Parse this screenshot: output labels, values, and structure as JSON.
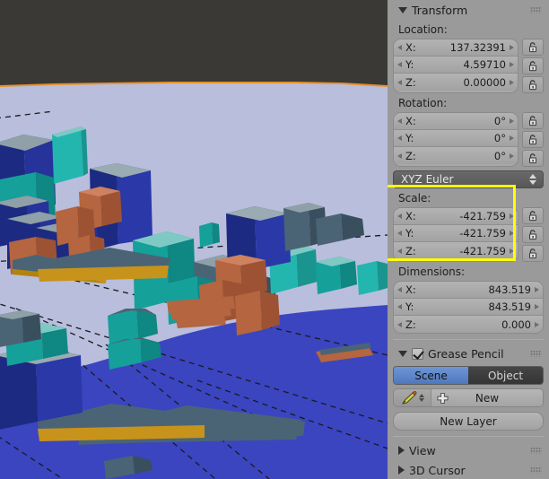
{
  "viewport": {
    "name": "3d-viewport",
    "background_color": "#3b3935",
    "ground_color": "#b9bedd",
    "water_color": "#3b45c0",
    "outline_color": "#e8912c",
    "building_colors": [
      "#1c2a82",
      "#15a09a",
      "#23b6ae",
      "#b5653f",
      "#c8931b",
      "#4a6475",
      "#8fa0a8"
    ]
  },
  "panel": {
    "transform": {
      "title": "Transform",
      "expanded": true,
      "location": {
        "label": "Location:",
        "rows": [
          {
            "axis": "X:",
            "value": "137.32391"
          },
          {
            "axis": "Y:",
            "value": "4.59710"
          },
          {
            "axis": "Z:",
            "value": "0.00000"
          }
        ],
        "locks": [
          "unlocked",
          "unlocked",
          "unlocked"
        ]
      },
      "rotation": {
        "label": "Rotation:",
        "rows": [
          {
            "axis": "X:",
            "value": "0°"
          },
          {
            "axis": "Y:",
            "value": "0°"
          },
          {
            "axis": "Z:",
            "value": "0°"
          }
        ],
        "locks": [
          "unlocked",
          "unlocked",
          "unlocked"
        ],
        "mode": "XYZ Euler"
      },
      "scale": {
        "label": "Scale:",
        "highlighted": true,
        "highlight_color": "#ffff00",
        "rows": [
          {
            "axis": "X:",
            "value": "-421.759"
          },
          {
            "axis": "Y:",
            "value": "-421.759"
          },
          {
            "axis": "Z:",
            "value": "-421.759"
          }
        ],
        "locks": [
          "unlocked",
          "unlocked",
          "unlocked"
        ]
      },
      "dimensions": {
        "label": "Dimensions:",
        "rows": [
          {
            "axis": "X:",
            "value": "843.519"
          },
          {
            "axis": "Y:",
            "value": "843.519"
          },
          {
            "axis": "Z:",
            "value": "0.000"
          }
        ]
      }
    },
    "grease_pencil": {
      "title": "Grease Pencil",
      "expanded": true,
      "checked": true,
      "toggle": {
        "active": "Scene",
        "inactive": "Object",
        "active_color": "#5680c2"
      },
      "new_button": "New",
      "new_layer_button": "New Layer"
    },
    "collapsed_panels": [
      {
        "title": "View"
      },
      {
        "title": "3D Cursor"
      }
    ]
  }
}
